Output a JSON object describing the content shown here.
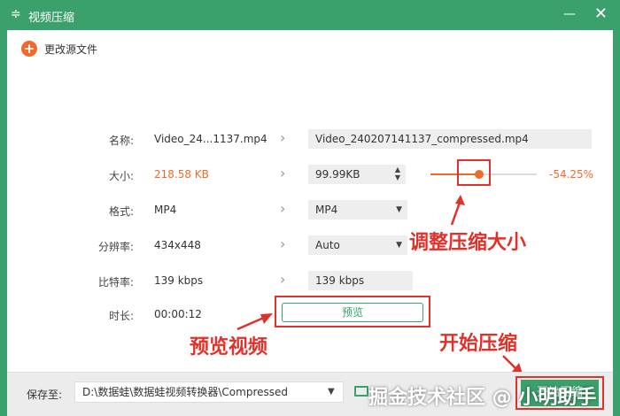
{
  "window": {
    "title": "视频压缩",
    "app_icon": "equalizer-icon",
    "minimize": "—",
    "close": "✕"
  },
  "toolbar": {
    "change_source_label": "更改源文件",
    "plus": "+"
  },
  "rows": {
    "name": {
      "label": "名称:",
      "source": "Video_24...1137.mp4",
      "target": "Video_240207141137_compressed.mp4"
    },
    "size": {
      "label": "大小:",
      "source": "218.58 KB",
      "target": "99.99KB",
      "percent": "-54.25%",
      "slider_fraction": 0.46
    },
    "format": {
      "label": "格式:",
      "source": "MP4",
      "target": "MP4"
    },
    "resolution": {
      "label": "分辨率:",
      "source": "434x448",
      "target": "Auto"
    },
    "bitrate": {
      "label": "比特率:",
      "source": "139 kbps",
      "target": "139 kbps"
    },
    "duration": {
      "label": "时长:",
      "source": "00:00:12"
    }
  },
  "preview_button": "预览",
  "annotations": {
    "adjust_size": "调整压缩大小",
    "preview_video": "预览视频",
    "start_compress": "开始压缩"
  },
  "bottom": {
    "save_to_label": "保存至:",
    "save_path": "D:\\数据蛙\\数据蛙视频转换器\\Compressed",
    "start_label": "开始压缩",
    "watermark": "掘金技术社区 @ 小明助手"
  },
  "colors": {
    "accent": "#3aa06c",
    "warning": "#f06a2b",
    "annotation": "#e0322a"
  }
}
